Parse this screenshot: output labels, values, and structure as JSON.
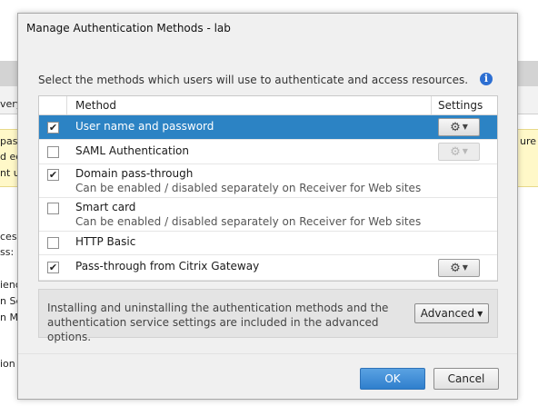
{
  "background": {
    "fragments": [
      "very",
      "pas",
      "d ed",
      "nt u",
      "ure a",
      "ces",
      "ss:",
      "ienc",
      "n Se",
      "n M",
      "ion s"
    ]
  },
  "dialog": {
    "title": "Manage Authentication Methods - lab",
    "instruction": "Select the methods which users will use to authenticate and access resources.",
    "info_icon": "info-icon",
    "table": {
      "header_method": "Method",
      "header_settings": "Settings",
      "rows": [
        {
          "label": "User name and password",
          "sublabel": "",
          "checked": true,
          "selected": true,
          "settings": "enabled"
        },
        {
          "label": "SAML Authentication",
          "sublabel": "",
          "checked": false,
          "selected": false,
          "settings": "disabled"
        },
        {
          "label": "Domain pass-through",
          "sublabel": "Can be enabled / disabled separately on Receiver for Web sites",
          "checked": true,
          "selected": false,
          "settings": "none"
        },
        {
          "label": "Smart card",
          "sublabel": "Can be enabled / disabled separately on Receiver for Web sites",
          "checked": false,
          "selected": false,
          "settings": "none"
        },
        {
          "label": "HTTP Basic",
          "sublabel": "",
          "checked": false,
          "selected": false,
          "settings": "none"
        },
        {
          "label": "Pass-through from Citrix Gateway",
          "sublabel": "",
          "checked": true,
          "selected": false,
          "settings": "enabled"
        }
      ]
    },
    "advanced": {
      "text": "Installing and uninstalling the authentication methods and the authentication service settings are included in the advanced options.",
      "button_label": "Advanced"
    },
    "ok_label": "OK",
    "cancel_label": "Cancel"
  },
  "colors": {
    "selection": "#2c83c4",
    "ok_button": "#3a8ad6",
    "background_warning": "#fff8c8",
    "background_toolbar": "#d6d6d6"
  }
}
